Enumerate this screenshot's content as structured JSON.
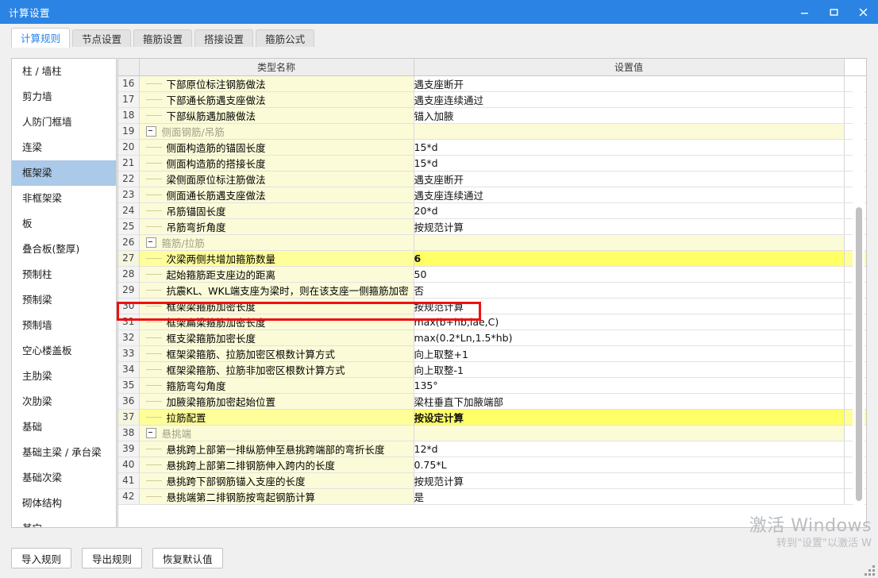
{
  "window": {
    "title": "计算设置",
    "controls": {
      "minimize": "minimize",
      "maximize": "maximize",
      "close": "close"
    }
  },
  "tabs": [
    {
      "label": "计算规则",
      "active": true
    },
    {
      "label": "节点设置",
      "active": false
    },
    {
      "label": "箍筋设置",
      "active": false
    },
    {
      "label": "搭接设置",
      "active": false
    },
    {
      "label": "箍筋公式",
      "active": false
    }
  ],
  "sidebar": {
    "selected": "框架梁",
    "items": [
      {
        "label": "柱 / 墙柱"
      },
      {
        "label": "剪力墙"
      },
      {
        "label": "人防门框墙"
      },
      {
        "label": "连梁"
      },
      {
        "label": "框架梁"
      },
      {
        "label": "非框架梁"
      },
      {
        "label": "板"
      },
      {
        "label": "叠合板(整厚)"
      },
      {
        "label": "预制柱"
      },
      {
        "label": "预制梁"
      },
      {
        "label": "预制墙"
      },
      {
        "label": "空心楼盖板"
      },
      {
        "label": "主肋梁"
      },
      {
        "label": "次肋梁"
      },
      {
        "label": "基础"
      },
      {
        "label": "基础主梁 / 承台梁"
      },
      {
        "label": "基础次梁"
      },
      {
        "label": "砌体结构"
      },
      {
        "label": "其它"
      }
    ]
  },
  "grid": {
    "columns": {
      "number": "",
      "name": "类型名称",
      "value": "设置值"
    },
    "rows": [
      {
        "num": "16",
        "name": "下部原位标注钢筋做法",
        "value": "遇支座断开",
        "type": "leaf",
        "highlight": false
      },
      {
        "num": "17",
        "name": "下部通长筋遇支座做法",
        "value": "遇支座连续通过",
        "type": "leaf",
        "highlight": false
      },
      {
        "num": "18",
        "name": "下部纵筋遇加腋做法",
        "value": "锚入加腋",
        "type": "leaf",
        "highlight": false
      },
      {
        "num": "19",
        "name": "侧面钢筋/吊筋",
        "value": "",
        "type": "group",
        "highlight": false
      },
      {
        "num": "20",
        "name": "侧面构造筋的锚固长度",
        "value": "15*d",
        "type": "leaf",
        "highlight": false
      },
      {
        "num": "21",
        "name": "侧面构造筋的搭接长度",
        "value": "15*d",
        "type": "leaf",
        "highlight": false
      },
      {
        "num": "22",
        "name": "梁侧面原位标注筋做法",
        "value": "遇支座断开",
        "type": "leaf",
        "highlight": false
      },
      {
        "num": "23",
        "name": "侧面通长筋遇支座做法",
        "value": "遇支座连续通过",
        "type": "leaf",
        "highlight": false
      },
      {
        "num": "24",
        "name": "吊筋锚固长度",
        "value": "20*d",
        "type": "leaf",
        "highlight": false
      },
      {
        "num": "25",
        "name": "吊筋弯折角度",
        "value": "按规范计算",
        "type": "leaf",
        "highlight": false
      },
      {
        "num": "26",
        "name": "箍筋/拉筋",
        "value": "",
        "type": "group",
        "highlight": false
      },
      {
        "num": "27",
        "name": "次梁两侧共增加箍筋数量",
        "value": "6",
        "type": "leaf",
        "highlight": true
      },
      {
        "num": "28",
        "name": "起始箍筋距支座边的距离",
        "value": "50",
        "type": "leaf",
        "highlight": false
      },
      {
        "num": "29",
        "name": "抗震KL、WKL端支座为梁时，则在该支座一侧箍筋加密",
        "value": "否",
        "type": "leaf",
        "highlight": false
      },
      {
        "num": "30",
        "name": "框架梁箍筋加密长度",
        "value": "按规范计算",
        "type": "leaf",
        "highlight": false
      },
      {
        "num": "31",
        "name": "框架扁梁箍筋加密长度",
        "value": "max(b+hb,lae,C)",
        "type": "leaf",
        "highlight": false
      },
      {
        "num": "32",
        "name": "框支梁箍筋加密长度",
        "value": "max(0.2*Ln,1.5*hb)",
        "type": "leaf",
        "highlight": false
      },
      {
        "num": "33",
        "name": "框架梁箍筋、拉筋加密区根数计算方式",
        "value": "向上取整+1",
        "type": "leaf",
        "highlight": false
      },
      {
        "num": "34",
        "name": "框架梁箍筋、拉筋非加密区根数计算方式",
        "value": "向上取整-1",
        "type": "leaf",
        "highlight": false
      },
      {
        "num": "35",
        "name": "箍筋弯勾角度",
        "value": "135°",
        "type": "leaf",
        "highlight": false
      },
      {
        "num": "36",
        "name": "加腋梁箍筋加密起始位置",
        "value": "梁柱垂直下加腋端部",
        "type": "leaf",
        "highlight": false
      },
      {
        "num": "37",
        "name": "拉筋配置",
        "value": "按设定计算",
        "type": "leaf",
        "highlight": true
      },
      {
        "num": "38",
        "name": "悬挑端",
        "value": "",
        "type": "group",
        "highlight": false
      },
      {
        "num": "39",
        "name": "悬挑跨上部第一排纵筋伸至悬挑跨端部的弯折长度",
        "value": "12*d",
        "type": "leaf",
        "highlight": false
      },
      {
        "num": "40",
        "name": "悬挑跨上部第二排钢筋伸入跨内的长度",
        "value": "0.75*L",
        "type": "leaf",
        "highlight": false
      },
      {
        "num": "41",
        "name": "悬挑跨下部钢筋锚入支座的长度",
        "value": "按规范计算",
        "type": "leaf",
        "highlight": false
      },
      {
        "num": "42",
        "name": "悬挑端第二排钢筋按弯起钢筋计算",
        "value": "是",
        "type": "leaf",
        "highlight": false
      }
    ]
  },
  "footer": {
    "buttons": [
      {
        "label": "导入规则"
      },
      {
        "label": "导出规则"
      },
      {
        "label": "恢复默认值"
      }
    ]
  },
  "watermark": {
    "line1": "激活 Windows",
    "line2": "转到\"设置\"以激活 W"
  },
  "colors": {
    "titlebar": "#2b84e3",
    "accent": "#2b84e3",
    "sidebar_selected": "#abc9e8",
    "row_name_bg": "#fbfbd8",
    "row_highlight": "#ffff66",
    "annotation": "#ee1111"
  }
}
